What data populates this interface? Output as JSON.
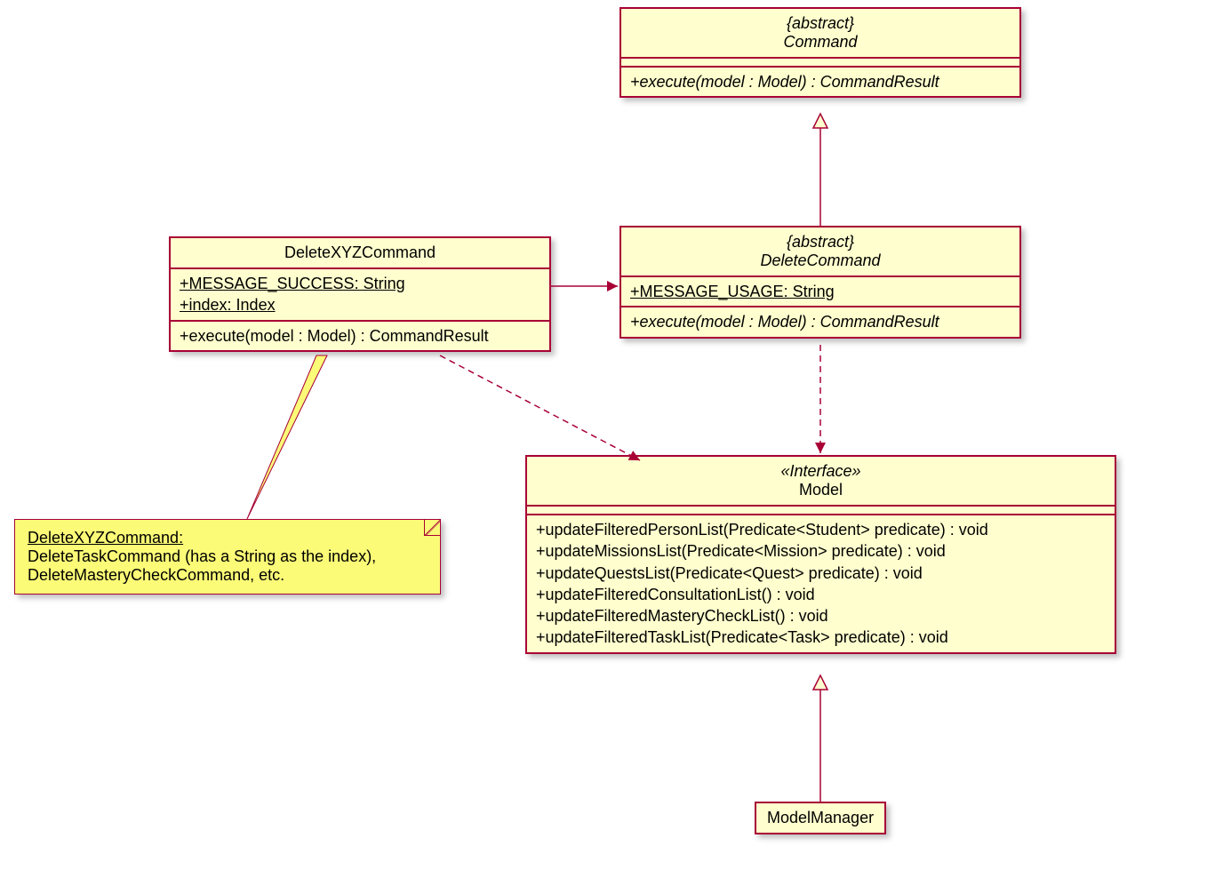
{
  "classes": {
    "command": {
      "stereotype": "{abstract}",
      "name": "Command",
      "methods": [
        "+execute(model : Model) : CommandResult"
      ]
    },
    "deleteCommand": {
      "stereotype": "{abstract}",
      "name": "DeleteCommand",
      "attrs": [
        "+MESSAGE_USAGE: String"
      ],
      "methods": [
        "+execute(model : Model) : CommandResult"
      ]
    },
    "deleteXYZ": {
      "name": "DeleteXYZCommand",
      "attrs": [
        "+MESSAGE_SUCCESS: String",
        "+index: Index"
      ],
      "methods": [
        "+execute(model : Model) : CommandResult"
      ]
    },
    "model": {
      "stereotype": "«Interface»",
      "name": "Model",
      "methods": [
        "+updateFilteredPersonList(Predicate<Student> predicate) : void",
        "+updateMissionsList(Predicate<Mission> predicate) : void",
        "+updateQuestsList(Predicate<Quest> predicate) : void",
        "+updateFilteredConsultationList() : void",
        "+updateFilteredMasteryCheckList() : void",
        "+updateFilteredTaskList(Predicate<Task> predicate) : void"
      ]
    },
    "modelManager": {
      "name": "ModelManager"
    }
  },
  "note": {
    "title": "DeleteXYZCommand:",
    "line1": "DeleteTaskCommand (has a String as the index),",
    "line2": "DeleteMasteryCheckCommand, etc."
  }
}
